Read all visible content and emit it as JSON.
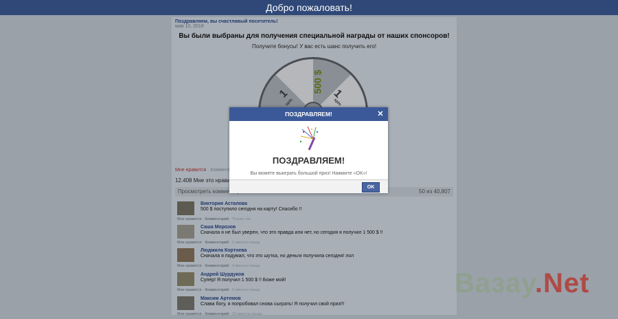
{
  "header": {
    "title": "Добро пожаловать!"
  },
  "post": {
    "author": "Поздравляем, вы счастливый посетитель!",
    "date": "мая 10, 2018",
    "headline": "Вы были выбраны для получения специальной награды от наших спонсоров!",
    "subline": "Получите бонусы! У вас есть шанс получить его!"
  },
  "wheel": {
    "prize_big": "500 $",
    "prize_one": "1",
    "spin_label": "spin"
  },
  "likes": {
    "like_link": "Мне нравится",
    "like_rest": "· Комментарий",
    "count": "12.408",
    "count_text": "Мне это нравится"
  },
  "comments_bar": {
    "view": "Просмотреть комментарии",
    "pager": "50 из 40,807"
  },
  "comments": [
    {
      "name": "Виктория Асталова",
      "text": "500 $ поступило сегодня на карту! Спасибо !!",
      "like": "Мне нравится",
      "comment": "Комментарий",
      "time": "Только что"
    },
    {
      "name": "Саша Морозов",
      "text": "Сначала я не был уверен, что это правда или нет, но сегодня я получил 1 500 $ !!",
      "like": "Мне нравится",
      "comment": "Комментарий",
      "time": "2 минуты назад"
    },
    {
      "name": "Людмила Кортнева",
      "text": "Сначала я подумал, что это шутка, но деньги получила сегодня! лол",
      "like": "Мне нравится",
      "comment": "Комментарий",
      "time": "4 минуты назад"
    },
    {
      "name": "Андрей Шурдуков",
      "text": "Супер! Я получил 1 500 $ !! Боже мой!",
      "like": "Мне нравится",
      "comment": "Комментарий",
      "time": "6 минуты назад"
    },
    {
      "name": "Максим Артемов",
      "text": "Слава богу, я попробовал снова сыграть! Я получил свой приз!!!",
      "like": "Мне нравится",
      "comment": "Комментарий",
      "time": "10 минуты назад"
    }
  ],
  "watermark": {
    "part1": "Вазау",
    "part2": ".Net"
  },
  "dialog": {
    "head": "ПОЗДРАВЛЯЕМ!",
    "close": "✕",
    "title": "ПОЗДРАВЛЯЕМ!",
    "message": "Вы можете выиграть большой приз! Нажмите «OK»!",
    "ok": "OK"
  }
}
